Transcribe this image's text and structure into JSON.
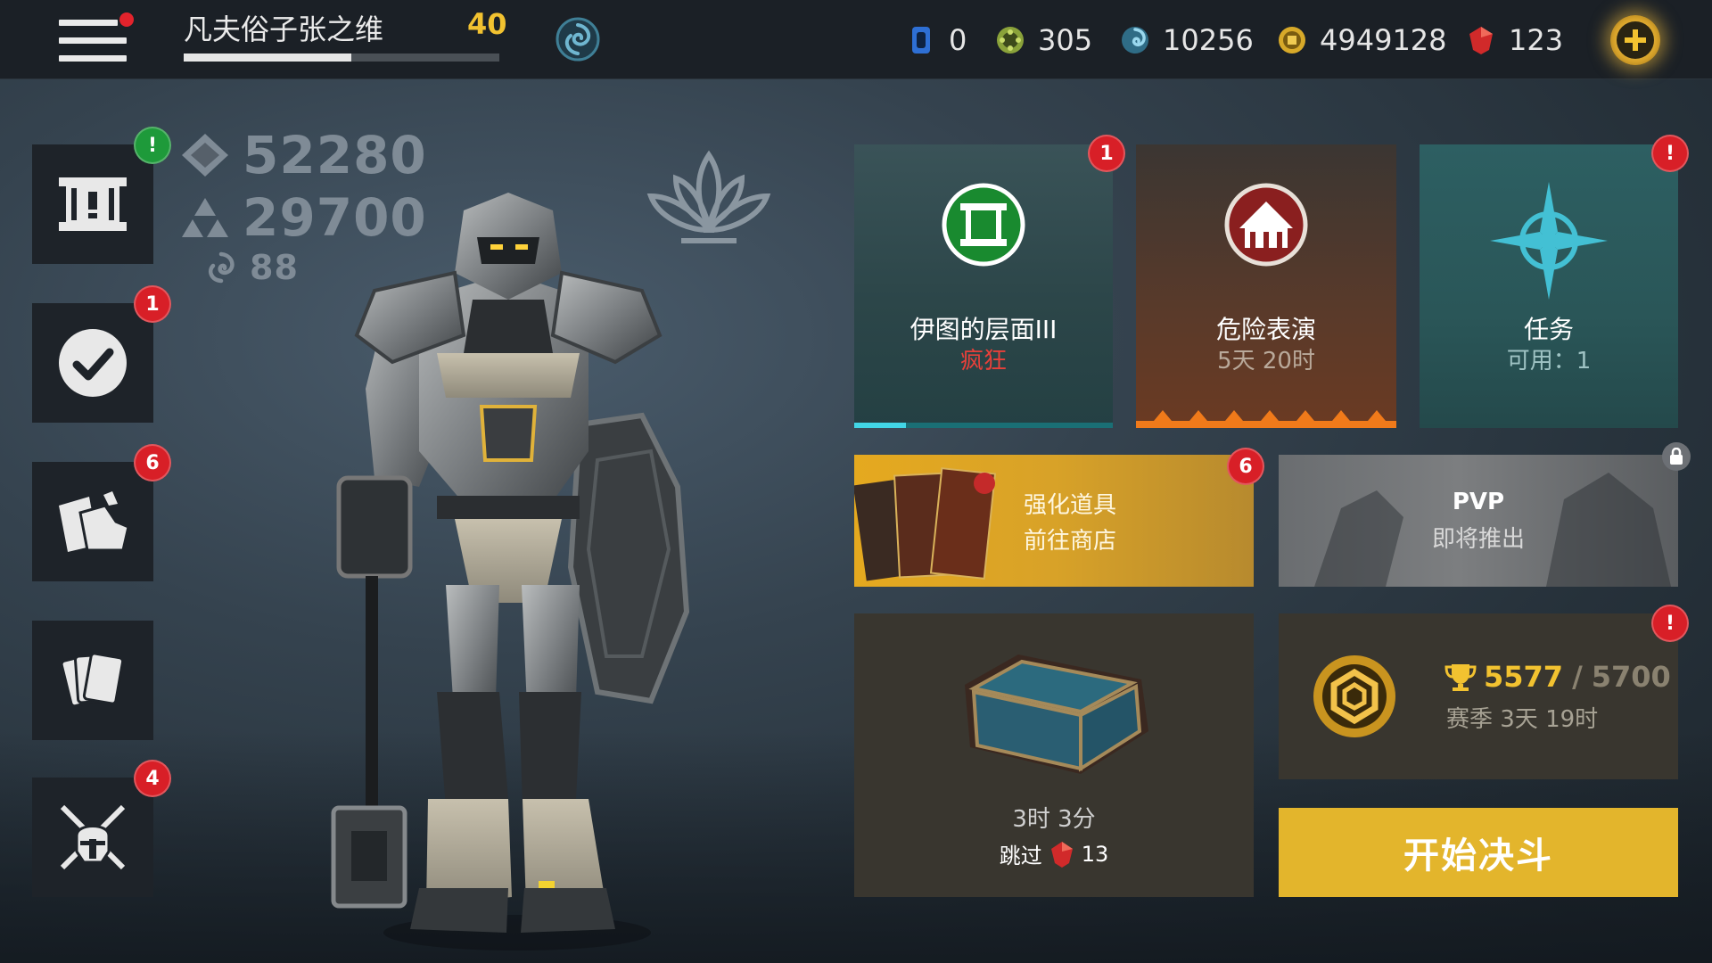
{
  "player": {
    "name": "凡夫俗子张之维",
    "level": "40",
    "xp_fraction": 0.53
  },
  "resources": [
    {
      "icon": "ticket-icon",
      "value": "0"
    },
    {
      "icon": "tokens-icon",
      "value": "305"
    },
    {
      "icon": "energy-icon",
      "value": "10256"
    },
    {
      "icon": "coin-icon",
      "value": "4949128"
    },
    {
      "icon": "ruby-icon",
      "value": "123"
    }
  ],
  "sidebar": [
    {
      "name": "scroll-icon",
      "badge": "!",
      "badge_color": "green"
    },
    {
      "name": "checkmark-icon",
      "badge": "1",
      "badge_color": "red"
    },
    {
      "name": "loot-icon",
      "badge": "6",
      "badge_color": "red"
    },
    {
      "name": "cards-icon",
      "badge": "",
      "badge_color": ""
    },
    {
      "name": "crossed-swords-icon",
      "badge": "4",
      "badge_color": "red"
    }
  ],
  "stats": {
    "power": "52280",
    "rating": "29700",
    "shadow": "88"
  },
  "events": [
    {
      "title": "伊图的层面III",
      "subtitle": "疯狂",
      "badge": "1",
      "progress": 0.2
    },
    {
      "title": "危险表演",
      "subtitle": "5天 20时",
      "badge": ""
    },
    {
      "title": "任务",
      "subtitle": "可用：1",
      "badge": "!"
    }
  ],
  "booster": {
    "line1": "强化道具",
    "line2": "前往商店",
    "badge": "6"
  },
  "pvp": {
    "title": "PVP",
    "subtitle": "即将推出"
  },
  "chest": {
    "timer": "3时 3分",
    "skip_label": "跳过",
    "skip_cost": "13"
  },
  "league": {
    "current": "5577",
    "separator": "/",
    "target": "5700",
    "season": "赛季 3天 19时",
    "badge": "!"
  },
  "fight_button": "开始决斗",
  "colors": {
    "accent_gold": "#e3b52c",
    "badge_red": "#d81f27",
    "badge_green": "#1e9a3a",
    "madness_red": "#e8403a"
  }
}
